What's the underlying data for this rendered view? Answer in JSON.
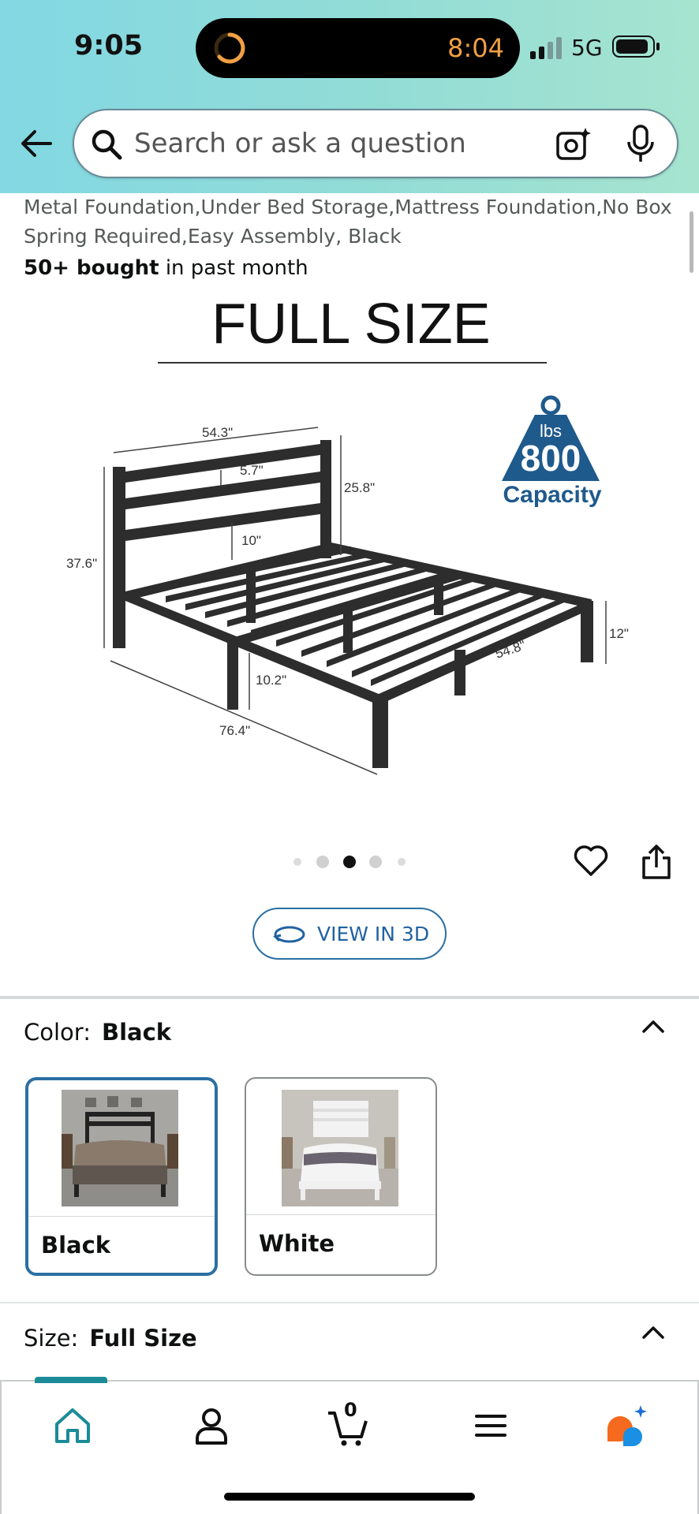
{
  "status_bar": {
    "time": "9:05",
    "island_time": "8:04",
    "network": "5G"
  },
  "search": {
    "placeholder": "Search or ask a question"
  },
  "product": {
    "description": "Metal Foundation,Under Bed Storage,Mattress Foundation,No Box Spring Required,Easy Assembly, Black",
    "bought_bold": "50+ bought",
    "bought_rest": " in past month"
  },
  "image": {
    "heading": "FULL SIZE",
    "badge_unit": "lbs",
    "badge_value": "800",
    "badge_label": "Capacity",
    "dims": {
      "width_head": "54.3\"",
      "rail_gap": "5.7\"",
      "headboard_h": "25.8\"",
      "clearance_head": "10\"",
      "total_h": "37.6\"",
      "leg_h": "10.2\"",
      "length": "76.4\"",
      "width_foot": "54.8\"",
      "foot_h": "12\""
    }
  },
  "carousel": {
    "count": 5,
    "active": 2
  },
  "view3d_label": "VIEW IN 3D",
  "color_section": {
    "label": "Color:",
    "value": "Black",
    "options": [
      {
        "label": "Black",
        "selected": true
      },
      {
        "label": "White",
        "selected": false
      }
    ]
  },
  "size_section": {
    "label": "Size:",
    "value": "Full Size"
  },
  "tabbar": {
    "items": [
      "home",
      "account",
      "cart",
      "menu",
      "rufus"
    ],
    "cart_count": "0",
    "accent": "#1b8b98"
  },
  "colors": {
    "header_gradient_start": "#82d8e3",
    "header_gradient_end": "#a6e4cf",
    "link_blue": "#2162a1",
    "badge_blue": "#1f5a8c"
  }
}
